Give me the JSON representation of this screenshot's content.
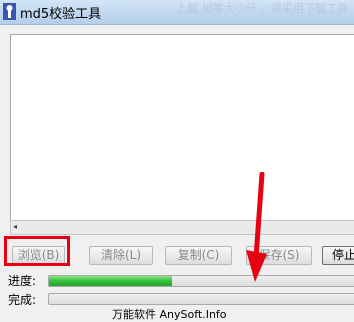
{
  "window": {
    "title": "md5校验工具",
    "background_title_fragment": "上载 相等大小分 ，请采用下载工具"
  },
  "output_area": {
    "text": ""
  },
  "buttons": {
    "browse": "浏览(B)",
    "clear": "清除(L)",
    "copy": "复制(C)",
    "save": "保存(S)",
    "stop": "停止"
  },
  "progress": {
    "label": "进度:",
    "fraction": 0.4
  },
  "done": {
    "label": "完成:",
    "fraction": 0
  },
  "footer": {
    "text": "万能软件 AnySoft.Info"
  },
  "colors": {
    "progress_fill": "#36c13a",
    "annotation_red": "#e60012"
  }
}
